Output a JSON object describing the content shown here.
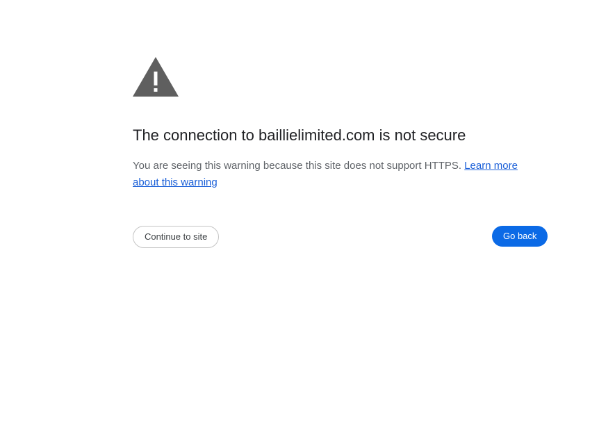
{
  "icon": "warning-triangle-icon",
  "title": "The connection to baillielimited.com is not secure",
  "message": {
    "text": "You are seeing this warning because this site does not support HTTPS. ",
    "link_label": "Learn more about this warning"
  },
  "actions": {
    "continue_label": "Continue to site",
    "go_back_label": "Go back"
  },
  "colors": {
    "accent": "#0b6ae6",
    "link": "#1a5fd8",
    "icon": "#5f5f5f"
  }
}
